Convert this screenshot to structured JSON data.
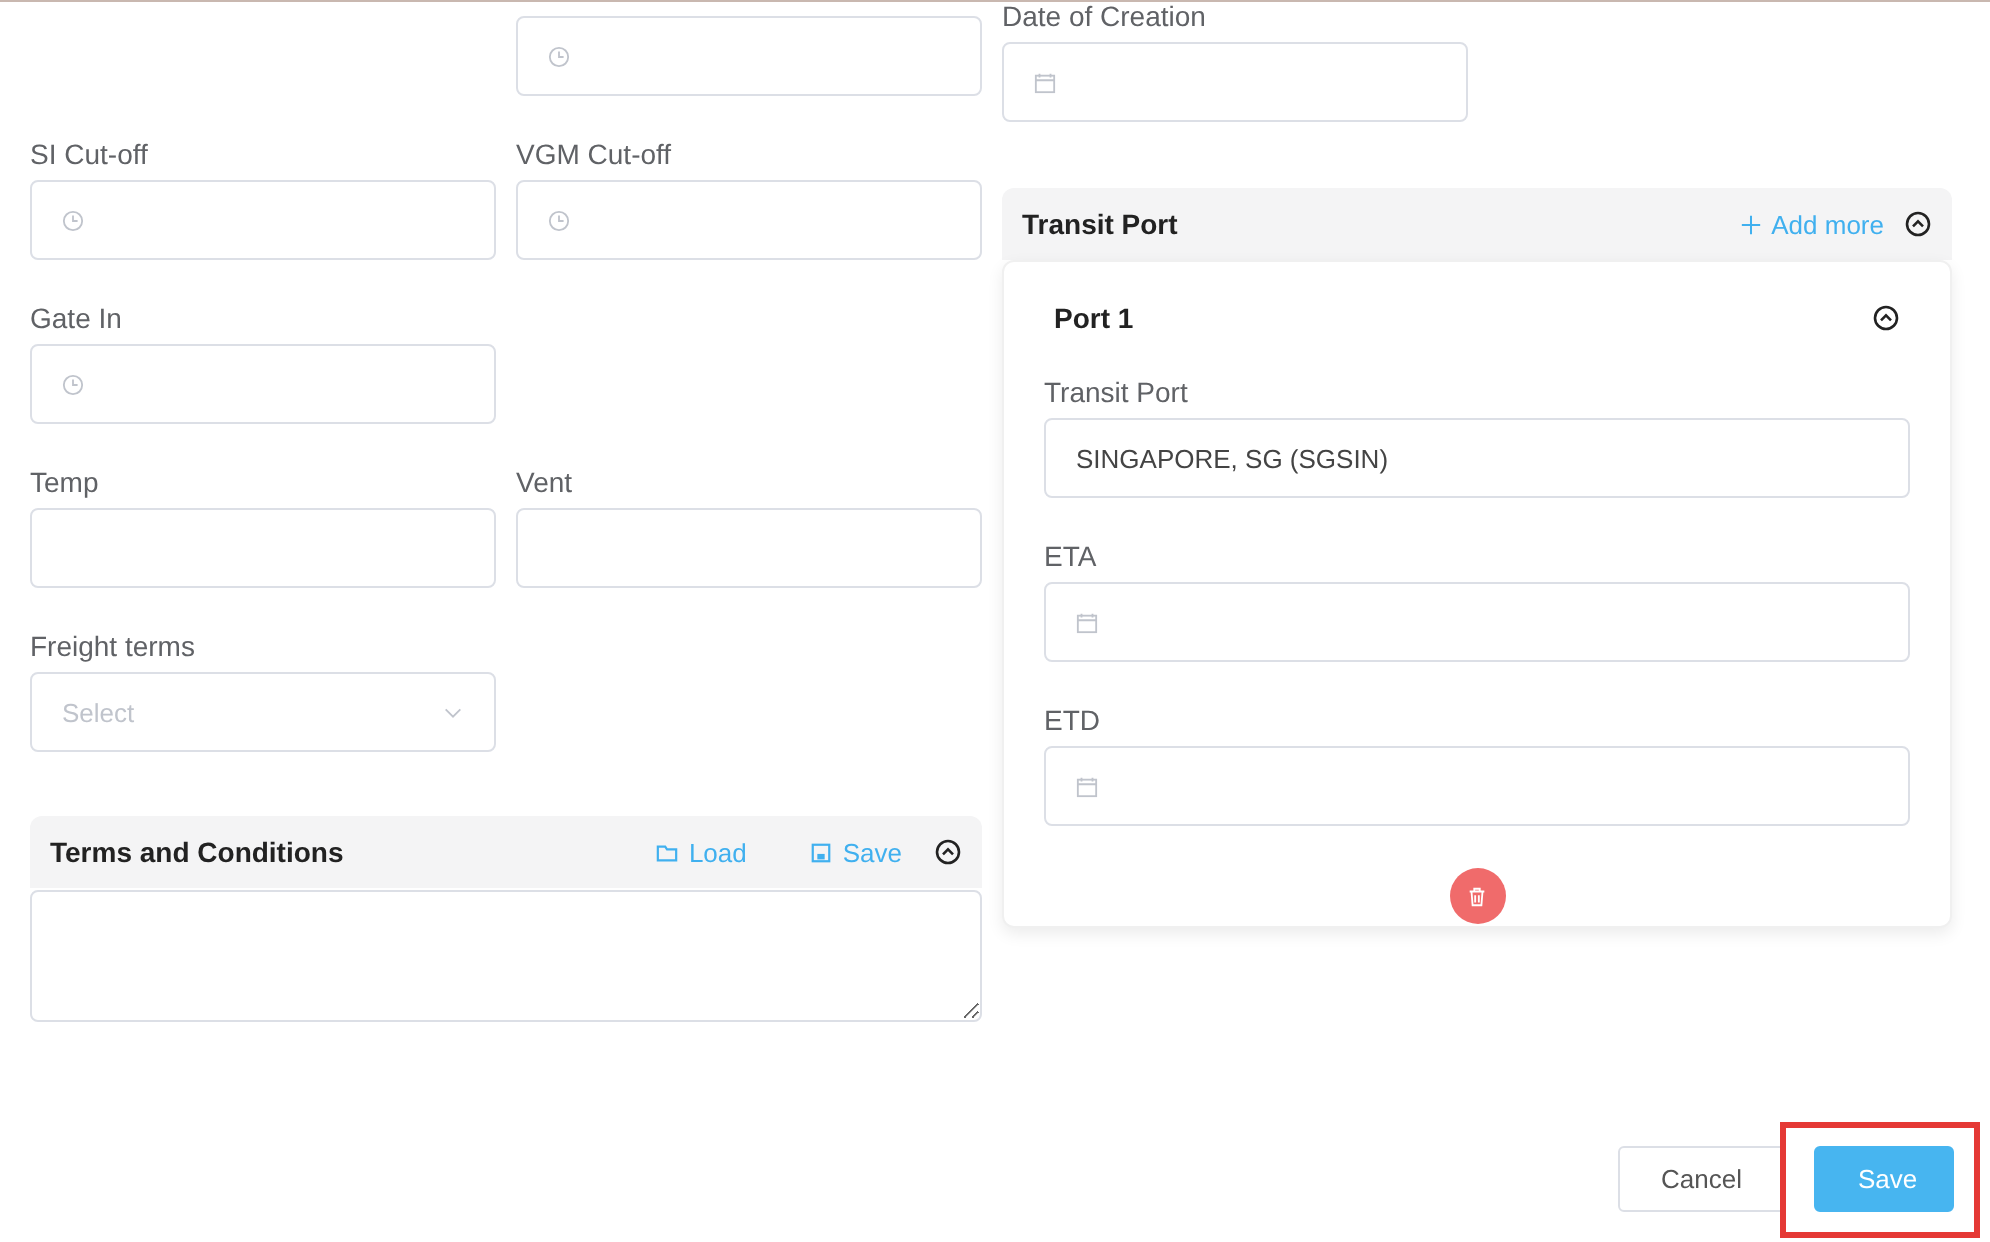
{
  "left_rows": [
    {
      "right": {
        "kind": "time"
      }
    },
    {
      "left": {
        "label": "SI Cut-off",
        "kind": "time"
      },
      "right": {
        "label": "VGM Cut-off",
        "kind": "time"
      }
    },
    {
      "left": {
        "label": "Gate In",
        "kind": "time"
      }
    },
    {
      "left": {
        "label": "Temp",
        "kind": "text"
      },
      "right": {
        "label": "Vent",
        "kind": "text"
      }
    },
    {
      "left": {
        "label": "Freight terms",
        "kind": "select",
        "placeholder": "Select"
      }
    }
  ],
  "date_of_creation": {
    "label": "Date of Creation",
    "kind": "date"
  },
  "terms_panel": {
    "title": "Terms and Conditions",
    "actions": [
      {
        "label": "Load",
        "kind": "folder"
      },
      {
        "label": "Save",
        "kind": "disk"
      }
    ],
    "expanded": true
  },
  "transit_panel": {
    "title": "Transit Port",
    "add_label": "Add more",
    "expanded": true,
    "ports": [
      {
        "title": "Port 1",
        "expanded": true,
        "fields": [
          {
            "label": "Transit Port",
            "kind": "text",
            "value": "SINGAPORE, SG (SGSIN)"
          },
          {
            "label": "ETA",
            "kind": "date"
          },
          {
            "label": "ETD",
            "kind": "date"
          }
        ]
      }
    ]
  },
  "footer": {
    "buttons": [
      {
        "label": "Cancel",
        "kind": "secondary"
      },
      {
        "label": "Save",
        "kind": "primary",
        "highlighted": true
      }
    ]
  }
}
